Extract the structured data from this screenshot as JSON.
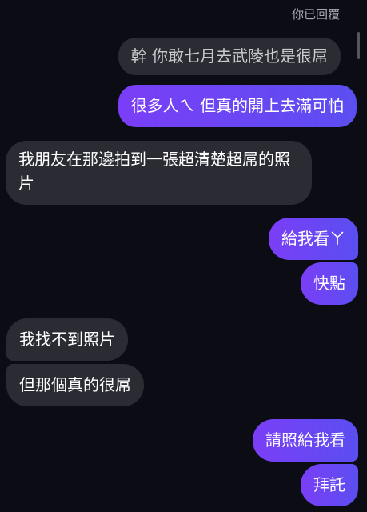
{
  "header": {
    "reply_label": "你已回覆"
  },
  "messages": [
    {
      "sender": "quoted",
      "text": "幹 你敢七月去武陵也是很屌"
    },
    {
      "sender": "me",
      "text": "很多人ㄟ 但真的開上去滿可怕"
    },
    {
      "sender": "friend",
      "text": "我朋友在那邊拍到一張超清楚超屌的照片"
    },
    {
      "sender": "me",
      "text": "給我看ㄚ"
    },
    {
      "sender": "me",
      "text": "快點"
    },
    {
      "sender": "friend",
      "text": "我找不到照片"
    },
    {
      "sender": "friend",
      "text": "但那個真的很屌"
    },
    {
      "sender": "me",
      "text": "請照給我看"
    },
    {
      "sender": "me",
      "text": "拜託"
    }
  ],
  "colors": {
    "background": "#0b0c14",
    "outgoing_start": "#7a3ef6",
    "outgoing_end": "#5b4ef1",
    "incoming": "#2a2b33"
  }
}
